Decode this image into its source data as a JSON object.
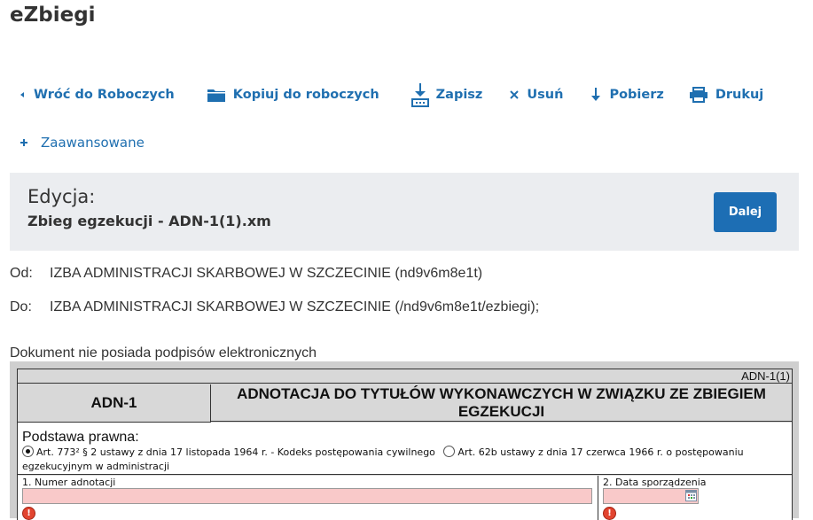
{
  "app": {
    "title": "eZbiegi"
  },
  "toolbar": {
    "back": "Wróć do Roboczych",
    "copy": "Kopiuj do roboczych",
    "save": "Zapisz",
    "delete": "Usuń",
    "download": "Pobierz",
    "print": "Drukuj"
  },
  "advanced": {
    "label": "Zaawansowane"
  },
  "edit": {
    "label": "Edycja:",
    "filename": "Zbieg egzekucji - ADN-1(1).xm",
    "next": "Dalej"
  },
  "addresses": {
    "from_label": "Od:",
    "from_value": "IZBA ADMINISTRACJI SKARBOWEJ W SZCZECINIE (nd9v6m8e1t)",
    "to_label": "Do:",
    "to_value": "IZBA ADMINISTRACJI SKARBOWEJ W SZCZECINIE (/nd9v6m8e1t/ezbiegi);"
  },
  "signature_note": "Dokument nie posiada podpisów elektronicznych",
  "form": {
    "code": "ADN-1(1)",
    "id": "ADN-1",
    "heading": "ADNOTACJA DO TYTUŁÓW WYKONAWCZYCH W ZWIĄZKU ZE ZBIEGIEM EGZEKUCJI",
    "legal_basis": {
      "title": "Podstawa prawna:",
      "option1": "Art. 773² § 2 ustawy z dnia 17 listopada 1964 r. - Kodeks postępowania cywilnego",
      "option2": "Art. 62b ustawy z dnia 17 czerwca 1966 r. o postępowaniu egzekucyjnym w administracji"
    },
    "fields": {
      "number_label": "1. Numer adnotacji",
      "number_value": "",
      "date_label": "2. Data sporządzenia",
      "date_value": ""
    }
  },
  "colors": {
    "accent": "#1f6fb0",
    "button": "#1d6eb4",
    "panel": "#ebedf0",
    "field_error": "#f9c9c9",
    "error_icon": "#e2442f"
  }
}
